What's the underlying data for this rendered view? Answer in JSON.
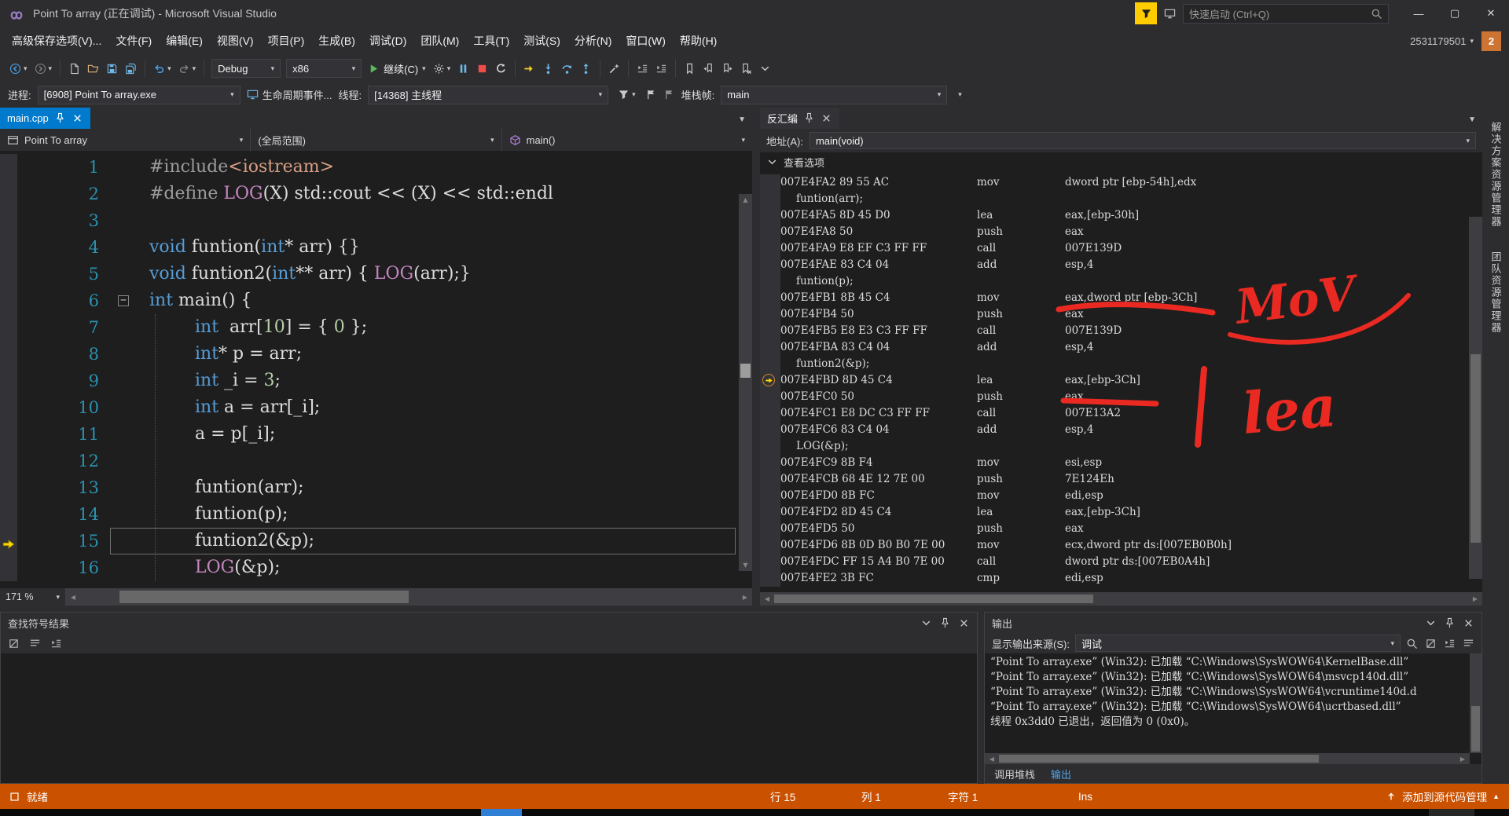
{
  "window": {
    "title": "Point To array (正在调试) - Microsoft Visual Studio",
    "quick_launch_placeholder": "快速启动 (Ctrl+Q)",
    "user_id": "2531179501",
    "notification_count": "2"
  },
  "menus": [
    "高级保存选项(V)...",
    "文件(F)",
    "编辑(E)",
    "视图(V)",
    "项目(P)",
    "生成(B)",
    "调试(D)",
    "团队(M)",
    "工具(T)",
    "测试(S)",
    "分析(N)",
    "窗口(W)",
    "帮助(H)"
  ],
  "toolbar": {
    "config": "Debug",
    "platform": "x86",
    "continue_label": "继续(C)",
    "items": [
      {
        "t": "btn",
        "icon": "nav-back",
        "c": "#4ba0e8",
        "caret": true
      },
      {
        "t": "btn",
        "icon": "nav-forward",
        "c": "#7f7f7f",
        "caret": true
      },
      {
        "t": "sep"
      },
      {
        "t": "btn",
        "icon": "doc-new",
        "c": "#c8c8c8"
      },
      {
        "t": "btn",
        "icon": "folder-open",
        "c": "#dcb67a"
      },
      {
        "t": "btn",
        "icon": "save",
        "c": "#6fb8e8"
      },
      {
        "t": "btn",
        "icon": "save-all",
        "c": "#6fb8e8"
      },
      {
        "t": "sep"
      },
      {
        "t": "btn",
        "icon": "undo",
        "c": "#4ba0e8",
        "caret": true
      },
      {
        "t": "btn",
        "icon": "redo",
        "c": "#7f7f7f",
        "caret": true
      },
      {
        "t": "sep"
      },
      {
        "t": "combo",
        "key": "config",
        "name": "solution-configurations",
        "w": 88
      },
      {
        "t": "combo",
        "key": "platform",
        "name": "solution-platforms",
        "w": 96
      },
      {
        "t": "continue"
      },
      {
        "t": "btn",
        "icon": "gear",
        "c": "#c8c8c8",
        "caret": true
      },
      {
        "t": "btn",
        "icon": "pause",
        "c": "#6fb8e8"
      },
      {
        "t": "btn",
        "icon": "stop",
        "c": "#ef4c4c"
      },
      {
        "t": "btn",
        "icon": "restart",
        "c": "#d8d8d8"
      },
      {
        "t": "sep"
      },
      {
        "t": "btn",
        "icon": "next-statement",
        "c": "#f2cb1d"
      },
      {
        "t": "btn",
        "icon": "step-into",
        "c": "#6fb8e8"
      },
      {
        "t": "btn",
        "icon": "step-over",
        "c": "#6fb8e8"
      },
      {
        "t": "btn",
        "icon": "step-out",
        "c": "#6fb8e8"
      },
      {
        "t": "sep"
      },
      {
        "t": "btn",
        "icon": "wand",
        "c": "#c8c8c8"
      },
      {
        "t": "sep"
      },
      {
        "t": "btn",
        "icon": "outdent",
        "c": "#b9b9b9"
      },
      {
        "t": "btn",
        "icon": "indent",
        "c": "#b9b9b9"
      },
      {
        "t": "sep"
      },
      {
        "t": "btn",
        "icon": "bookmark",
        "c": "#c8c8c8"
      },
      {
        "t": "btn",
        "icon": "bookmark-prev",
        "c": "#c8c8c8"
      },
      {
        "t": "btn",
        "icon": "bookmark-next",
        "c": "#c8c8c8"
      },
      {
        "t": "btn",
        "icon": "bookmark-clear",
        "c": "#c8c8c8"
      },
      {
        "t": "btn",
        "icon": "chev-down",
        "c": "#c8c8c8"
      }
    ]
  },
  "debugbar": {
    "process_label": "进程:",
    "process_value": "[6908] Point To array.exe",
    "lifecycle_label": "生命周期事件...",
    "thread_label": "线程:",
    "thread_value": "[14368] 主线程",
    "frame_label": "堆栈帧:",
    "frame_value": "main"
  },
  "editor": {
    "tab": "main.cpp",
    "nav_project": "Point To array",
    "nav_scope": "(全局范围)",
    "nav_member": "main()",
    "zoom": "171 %",
    "lines": [
      {
        "n": 1,
        "ind": 0,
        "segs": [
          [
            "pp",
            "#include"
          ],
          [
            "str",
            "<iostream>"
          ]
        ]
      },
      {
        "n": 2,
        "ind": 0,
        "segs": [
          [
            "pp",
            "#define "
          ],
          [
            "mac",
            "LOG"
          ],
          [
            "pl",
            "(X) std::cout << (X) << std::endl"
          ]
        ]
      },
      {
        "n": 3,
        "ind": 0,
        "segs": []
      },
      {
        "n": 4,
        "ind": 0,
        "segs": [
          [
            "kw",
            "void"
          ],
          [
            "pl",
            " funtion("
          ],
          [
            "kw",
            "int"
          ],
          [
            "pl",
            "* arr) {}"
          ]
        ]
      },
      {
        "n": 5,
        "ind": 0,
        "segs": [
          [
            "kw",
            "void"
          ],
          [
            "pl",
            " funtion2("
          ],
          [
            "kw",
            "int"
          ],
          [
            "pl",
            "** arr) { "
          ],
          [
            "mac",
            "LOG"
          ],
          [
            "pl",
            "(arr);}"
          ]
        ]
      },
      {
        "n": 6,
        "ind": 0,
        "fold": true,
        "segs": [
          [
            "kw",
            "int"
          ],
          [
            "pl",
            " main() {"
          ]
        ]
      },
      {
        "n": 7,
        "ind": 1,
        "segs": [
          [
            "kw",
            "int"
          ],
          [
            "pl",
            "  arr["
          ],
          [
            "num",
            "10"
          ],
          [
            "pl",
            "] = { "
          ],
          [
            "num",
            "0"
          ],
          [
            "pl",
            " };"
          ]
        ]
      },
      {
        "n": 8,
        "ind": 1,
        "segs": [
          [
            "kw",
            "int"
          ],
          [
            "pl",
            "* p = arr;"
          ]
        ]
      },
      {
        "n": 9,
        "ind": 1,
        "segs": [
          [
            "kw",
            "int"
          ],
          [
            "pl",
            " _i = "
          ],
          [
            "num",
            "3"
          ],
          [
            "pl",
            ";"
          ]
        ]
      },
      {
        "n": 10,
        "ind": 1,
        "segs": [
          [
            "kw",
            "int"
          ],
          [
            "pl",
            " a = arr[_i];"
          ]
        ]
      },
      {
        "n": 11,
        "ind": 1,
        "segs": [
          [
            "pl",
            "a = p[_i];"
          ]
        ]
      },
      {
        "n": 12,
        "ind": 1,
        "segs": []
      },
      {
        "n": 13,
        "ind": 1,
        "segs": [
          [
            "pl",
            "funtion(arr);"
          ]
        ]
      },
      {
        "n": 14,
        "ind": 1,
        "segs": [
          [
            "pl",
            "funtion(p);"
          ]
        ]
      },
      {
        "n": 15,
        "ind": 1,
        "current": true,
        "segs": [
          [
            "pl",
            "funtion2(&p);"
          ]
        ]
      },
      {
        "n": 16,
        "ind": 1,
        "segs": [
          [
            "mac",
            "LOG"
          ],
          [
            "pl",
            "(&p);"
          ]
        ]
      }
    ]
  },
  "disasm": {
    "tab": "反汇编",
    "address_label": "地址(A):",
    "address_value": "main(void)",
    "view_options": "查看选项",
    "rows": [
      {
        "a": "007E4FA2",
        "b": "89 55 AC",
        "m": "mov",
        "o": "dword ptr [ebp-54h],edx"
      },
      {
        "src": "funtion(arr);"
      },
      {
        "a": "007E4FA5",
        "b": "8D 45 D0",
        "m": "lea",
        "o": "eax,[ebp-30h]"
      },
      {
        "a": "007E4FA8",
        "b": "50",
        "m": "push",
        "o": "eax"
      },
      {
        "a": "007E4FA9",
        "b": "E8 EF C3 FF FF",
        "m": "call",
        "o": "007E139D"
      },
      {
        "a": "007E4FAE",
        "b": "83 C4 04",
        "m": "add",
        "o": "esp,4"
      },
      {
        "src": "funtion(p);"
      },
      {
        "a": "007E4FB1",
        "b": "8B 45 C4",
        "m": "mov",
        "o": "eax,dword ptr [ebp-3Ch]"
      },
      {
        "a": "007E4FB4",
        "b": "50",
        "m": "push",
        "o": "eax"
      },
      {
        "a": "007E4FB5",
        "b": "E8 E3 C3 FF FF",
        "m": "call",
        "o": "007E139D"
      },
      {
        "a": "007E4FBA",
        "b": "83 C4 04",
        "m": "add",
        "o": "esp,4"
      },
      {
        "src": "funtion2(&p);"
      },
      {
        "a": "007E4FBD",
        "b": "8D 45 C4",
        "m": "lea",
        "o": "eax,[ebp-3Ch]",
        "cur": true
      },
      {
        "a": "007E4FC0",
        "b": "50",
        "m": "push",
        "o": "eax"
      },
      {
        "a": "007E4FC1",
        "b": "E8 DC C3 FF FF",
        "m": "call",
        "o": "007E13A2"
      },
      {
        "a": "007E4FC6",
        "b": "83 C4 04",
        "m": "add",
        "o": "esp,4"
      },
      {
        "src": "LOG(&p);"
      },
      {
        "a": "007E4FC9",
        "b": "8B F4",
        "m": "mov",
        "o": "esi,esp"
      },
      {
        "a": "007E4FCB",
        "b": "68 4E 12 7E 00",
        "m": "push",
        "o": "7E124Eh"
      },
      {
        "a": "007E4FD0",
        "b": "8B FC",
        "m": "mov",
        "o": "edi,esp"
      },
      {
        "a": "007E4FD2",
        "b": "8D 45 C4",
        "m": "lea",
        "o": "eax,[ebp-3Ch]"
      },
      {
        "a": "007E4FD5",
        "b": "50",
        "m": "push",
        "o": "eax"
      },
      {
        "a": "007E4FD6",
        "b": "8B 0D B0 B0 7E 00",
        "m": "mov",
        "o": "ecx,dword ptr ds:[007EB0B0h]"
      },
      {
        "a": "007E4FDC",
        "b": "FF 15 A4 B0 7E 00",
        "m": "call",
        "o": "dword ptr ds:[007EB0A4h]"
      },
      {
        "a": "007E4FE2",
        "b": "3B FC",
        "m": "cmp",
        "o": "edi,esp"
      }
    ]
  },
  "right_tabs": [
    "解决方案资源管理器",
    "团队资源管理器"
  ],
  "find_symbol_panel": {
    "title": "查找符号结果"
  },
  "output_panel": {
    "title": "输出",
    "source_label": "显示输出来源(S):",
    "source_value": "调试",
    "lines": [
      "“Point To array.exe” (Win32): 已加载 “C:\\Windows\\SysWOW64\\KernelBase.dll”",
      "“Point To array.exe” (Win32): 已加载 “C:\\Windows\\SysWOW64\\msvcp140d.dll”",
      "“Point To array.exe” (Win32): 已加载 “C:\\Windows\\SysWOW64\\vcruntime140d.d",
      "“Point To array.exe” (Win32): 已加载 “C:\\Windows\\SysWOW64\\ucrtbased.dll”",
      "线程 0x3dd0 已退出，返回值为 0 (0x0)。"
    ],
    "tabs": [
      "调用堆栈",
      "输出"
    ],
    "active_tab": "输出"
  },
  "statusbar": {
    "ready": "就绪",
    "line": "行 15",
    "col": "列 1",
    "char": "字符 1",
    "mode": "Ins",
    "source_control": "添加到源代码管理"
  },
  "annotations": {
    "mov_label": "MoV",
    "lea_label": "lea"
  },
  "colors": {
    "accent": "#007acc",
    "debug_orange": "#ca5100",
    "annotation_red": "#ea2a22"
  }
}
